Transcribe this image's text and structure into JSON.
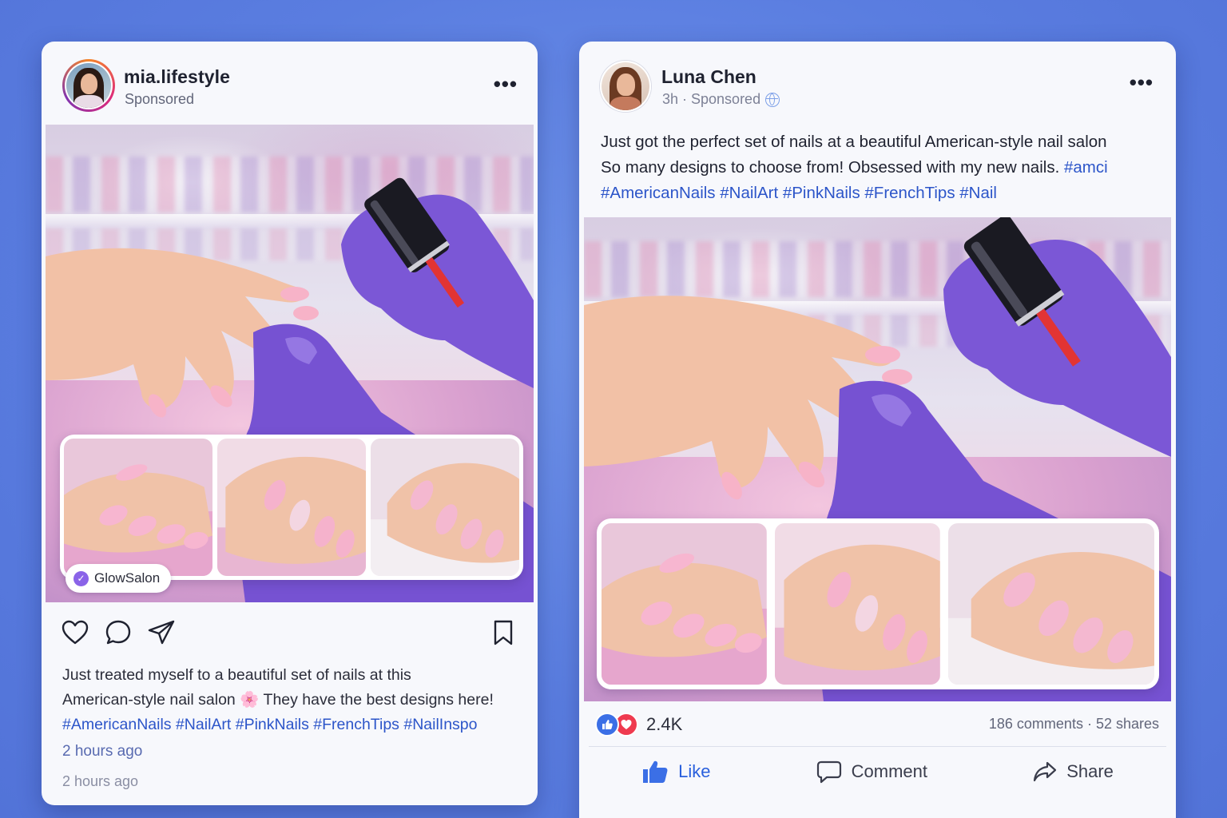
{
  "instagram_post": {
    "username": "mia.lifestyle",
    "sponsored_label": "Sponsored",
    "store_tag": "GlowSalon",
    "caption_line1": "Just treated myself to a beautiful set of nails at this",
    "caption_line2a": "American-style nail salon ",
    "caption_emoji": "🌸",
    "caption_line2b": " They have the best designs here!",
    "hashtags": "#AmericanNails #NailArt #PinkNails #FrenchTips #NailInspo",
    "time_primary": "2 hours ago",
    "time_secondary": "2 hours ago",
    "more_menu": "•••"
  },
  "facebook_post": {
    "name": "Luna Chen",
    "meta": "3h · Sponsored",
    "more_menu": "•••",
    "text_line1": "Just got the perfect set of nails at a beautiful American-style nail salon",
    "text_line2": "So many designs to choose from!  Obsessed with my new nails. ",
    "text_line2_tag": "#amci",
    "hashtags": "#AmericanNails #NailArt #PinkNails #FrenchTips #Nail",
    "reaction_count": "2.4K",
    "comments_shares": "186 comments · 52 shares",
    "actions": {
      "like": "Like",
      "comment": "Comment",
      "share": "Share"
    }
  },
  "colors": {
    "background": "#5a7de0",
    "hashtag_blue": "#2c55c9",
    "glove_purple": "#7b57d6",
    "nail_pink": "#f4a9c6",
    "like_blue": "#3b6fe6",
    "love_red": "#ef3a4f"
  },
  "icons": [
    "heart-icon",
    "comment-icon",
    "send-icon",
    "bookmark-icon",
    "globe-icon",
    "thumbs-up-icon",
    "comment-bubble-icon",
    "share-arrow-icon",
    "verified-check-icon"
  ]
}
